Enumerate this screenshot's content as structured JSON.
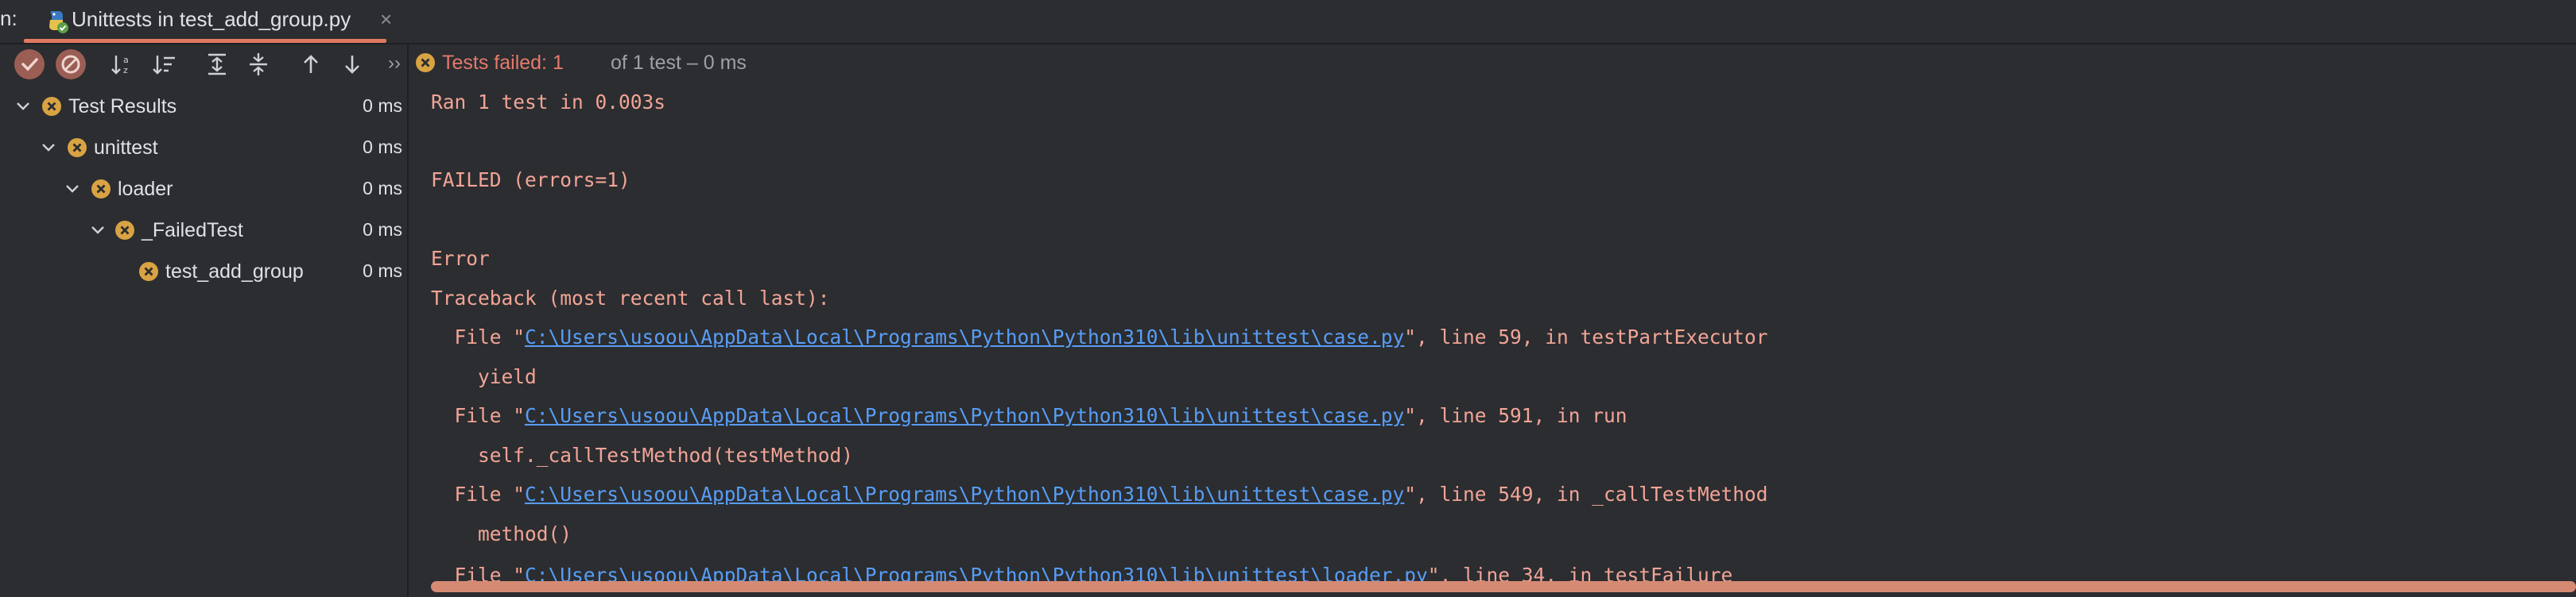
{
  "run_prefix": "n:",
  "tab": {
    "title": "Unittests in test_add_group.py",
    "close": "×"
  },
  "toolbar": {
    "buttons": [
      "show-passed",
      "show-ignored",
      "sort-alpha",
      "sort-duration",
      "expand-all",
      "collapse-all",
      "prev-failed",
      "next-failed"
    ],
    "more": "››"
  },
  "tree": [
    {
      "label": "Test Results",
      "duration": "0 ms"
    },
    {
      "label": "unittest",
      "duration": "0 ms"
    },
    {
      "label": "loader",
      "duration": "0 ms"
    },
    {
      "label": "_FailedTest",
      "duration": "0 ms"
    },
    {
      "label": "test_add_group",
      "duration": "0 ms"
    }
  ],
  "status": {
    "failed_label": "Tests failed: 1",
    "rest": "of 1 test – 0 ms"
  },
  "console": {
    "ran": "Ran 1 test in 0.003s",
    "failed": "FAILED (errors=1)",
    "error": "Error",
    "traceback": "Traceback (most recent call last):",
    "frames": [
      {
        "prefix": "  File \"",
        "path": "C:\\Users\\usoou\\AppData\\Local\\Programs\\Python\\Python310\\lib\\unittest\\case.py",
        "suffix": "\", line 59, in testPartExecutor",
        "code": "    yield"
      },
      {
        "prefix": "  File \"",
        "path": "C:\\Users\\usoou\\AppData\\Local\\Programs\\Python\\Python310\\lib\\unittest\\case.py",
        "suffix": "\", line 591, in run",
        "code": "    self._callTestMethod(testMethod)"
      },
      {
        "prefix": "  File \"",
        "path": "C:\\Users\\usoou\\AppData\\Local\\Programs\\Python\\Python310\\lib\\unittest\\case.py",
        "suffix": "\", line 549, in _callTestMethod",
        "code": "    method()"
      },
      {
        "prefix": "  File \"",
        "path": "C:\\Users\\usoou\\AppData\\Local\\Programs\\Python\\Python310\\lib\\unittest\\loader.py",
        "suffix": "\", line 34, in testFailure",
        "code": ""
      }
    ]
  },
  "colors": {
    "error": "#e57a6c",
    "link": "#589df6",
    "console_text": "#f2a496",
    "status_icon": "#d9a343",
    "background": "#2b2d30"
  }
}
